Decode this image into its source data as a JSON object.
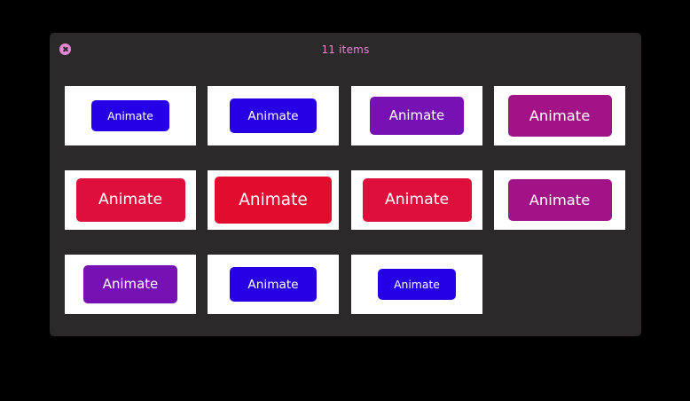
{
  "window": {
    "title": "11 items"
  },
  "items": [
    {
      "label": "Animate",
      "color": "#2500e6",
      "scale": 0.59
    },
    {
      "label": "Animate",
      "color": "#2700e4",
      "scale": 0.65
    },
    {
      "label": "Animate",
      "color": "#7612b3",
      "scale": 0.71
    },
    {
      "label": "Animate",
      "color": "#a31388",
      "scale": 0.78
    },
    {
      "label": "Animate",
      "color": "#df0f3c",
      "scale": 0.82
    },
    {
      "label": "Animate",
      "color": "#e20c2e",
      "scale": 0.88
    },
    {
      "label": "Animate",
      "color": "#df0f3c",
      "scale": 0.82
    },
    {
      "label": "Animate",
      "color": "#a31388",
      "scale": 0.78
    },
    {
      "label": "Animate",
      "color": "#7612b3",
      "scale": 0.71
    },
    {
      "label": "Animate",
      "color": "#2700e4",
      "scale": 0.65
    },
    {
      "label": "Animate",
      "color": "#2500e6",
      "scale": 0.59
    }
  ]
}
